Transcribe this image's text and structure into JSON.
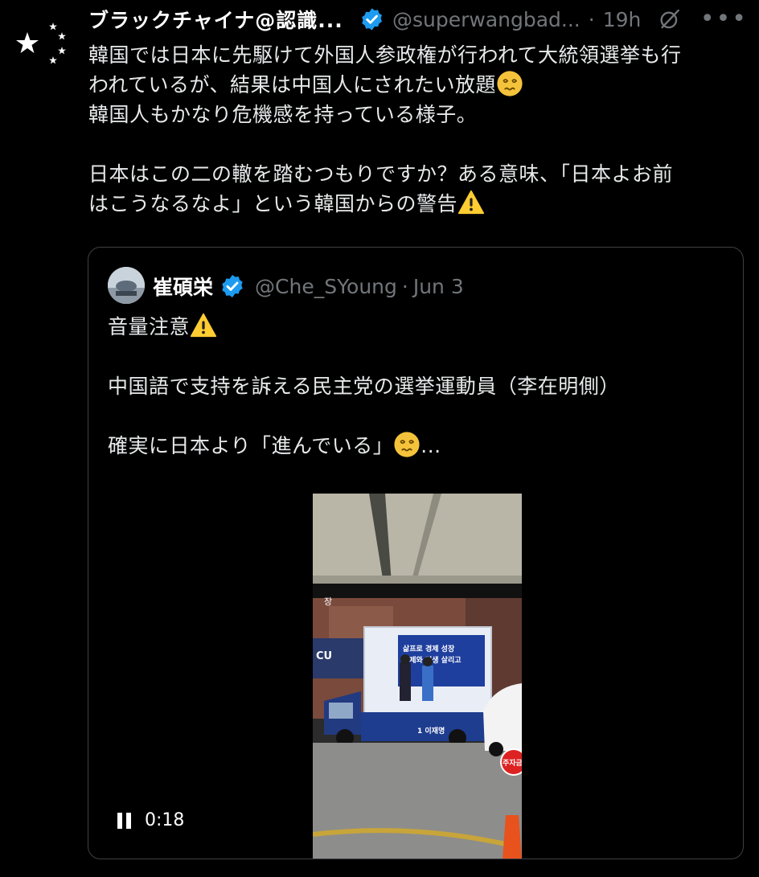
{
  "tweet": {
    "display_name": "ブラックチャイナ@認識...",
    "handle": "@superwangbad...",
    "dot": "·",
    "time": "19h",
    "more": "•••",
    "lines": [
      "韓国では日本に先駆けて外国人参政権が行われて大統領選挙も行",
      "われているが、結果は中国人にされたい放題",
      "韓国人もかなり危機感を持っている様子。",
      "日本はこの二の轍を踏むつもりですか？ある意味、「日本よお前",
      "はこうなるなよ」という韓国からの警告"
    ]
  },
  "quote": {
    "display_name": "崔碩栄",
    "handle": "@Che_SYoung",
    "dot": "·",
    "time": "Jun 3",
    "lines": [
      "音量注意",
      "中国語で支持を訴える民主党の選挙運動員（李在明側）",
      "確実に日本より「進んでいる」",
      "..."
    ],
    "video": {
      "duration": "0:18",
      "state": "playing",
      "truck_sign_text": [
        "삶프로 경제 성장",
        "경제와 민생 살리고"
      ],
      "truck_footer_text": "1 이재명",
      "store_sign": "CU",
      "parking_sign": "주자금지"
    }
  },
  "colors": {
    "background": "#000000",
    "text": "#e7e9ea",
    "muted": "#71767b",
    "verified_blue": "#1d9bf0",
    "border": "#3e4144"
  },
  "icons": [
    "star-flag-avatar-icon",
    "verified-badge-icon",
    "grok-icon",
    "more-icon",
    "dizzy-face-emoji-icon",
    "warning-emoji-icon",
    "pause-icon"
  ]
}
